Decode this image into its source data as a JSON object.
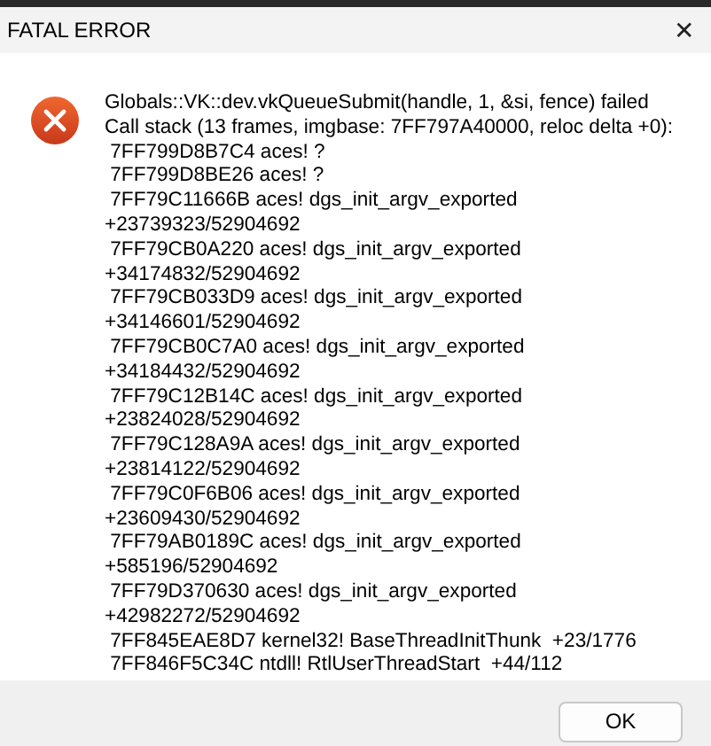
{
  "window": {
    "title": "FATAL ERROR",
    "close": "✕"
  },
  "message": {
    "lines": [
      "Globals::VK::dev.vkQueueSubmit(handle, 1, &si, fence) failed",
      "Call stack (13 frames, imgbase: 7FF797A40000, reloc delta +0):",
      " 7FF799D8B7C4 aces! ?",
      " 7FF799D8BE26 aces! ?",
      " 7FF79C11666B aces! dgs_init_argv_exported",
      "+23739323/52904692",
      " 7FF79CB0A220 aces! dgs_init_argv_exported",
      "+34174832/52904692",
      " 7FF79CB033D9 aces! dgs_init_argv_exported",
      "+34146601/52904692",
      " 7FF79CB0C7A0 aces! dgs_init_argv_exported",
      "+34184432/52904692",
      " 7FF79C12B14C aces! dgs_init_argv_exported",
      "+23824028/52904692",
      " 7FF79C128A9A aces! dgs_init_argv_exported",
      "+23814122/52904692",
      " 7FF79C0F6B06 aces! dgs_init_argv_exported",
      "+23609430/52904692",
      " 7FF79AB0189C aces! dgs_init_argv_exported",
      "+585196/52904692",
      " 7FF79D370630 aces! dgs_init_argv_exported",
      "+42982272/52904692",
      " 7FF845EAE8D7 kernel32! BaseThreadInitThunk  +23/1776",
      " 7FF846F5C34C ntdll! RtlUserThreadStart  +44/112"
    ]
  },
  "buttons": [
    "OK"
  ]
}
